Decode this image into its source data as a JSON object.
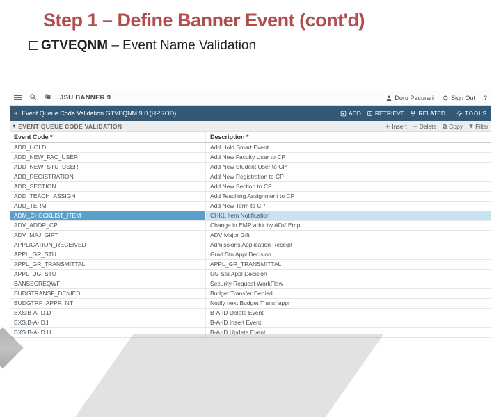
{
  "slide": {
    "title": "Step 1 – Define Banner Event (cont'd)",
    "sub_bold": "GTVEQNM",
    "sub_rest": " – Event Name Validation"
  },
  "topbar": {
    "brand": "JSU BANNER 9",
    "user": "Doru Pacurari",
    "signout": "Sign Out",
    "help": "?"
  },
  "subhead": {
    "caret": "×",
    "title": "Event Queue Code Validation GTVEQNM 9.0 (HPROD)",
    "add": "ADD",
    "retrieve": "RETRIEVE",
    "related": "RELATED",
    "tools": "TOOLS"
  },
  "section": {
    "caret": "▾",
    "title": "EVENT QUEUE CODE VALIDATION",
    "insert": "Insert",
    "delete": "Delete",
    "copy": "Copy",
    "filter": "Filter"
  },
  "headers": {
    "code": "Event Code *",
    "desc": "Description *"
  },
  "rows": [
    {
      "code": "ADD_HOLD",
      "desc": "Add Hold Smart Event"
    },
    {
      "code": "ADD_NEW_FAC_USER",
      "desc": "Add New Faculty User to CP"
    },
    {
      "code": "ADD_NEW_STU_USER",
      "desc": "Add New Student User to CP"
    },
    {
      "code": "ADD_REGISTRATION",
      "desc": "Add New Registration to CP"
    },
    {
      "code": "ADD_SECTION",
      "desc": "Add New Section to CP"
    },
    {
      "code": "ADD_TEACH_ASSIGN",
      "desc": "Add Teaching Assignment to CP"
    },
    {
      "code": "ADD_TERM",
      "desc": "Add New Term to CP"
    },
    {
      "code": "ADM_CHECKLIST_ITEM",
      "desc": "CHKL Item Notification",
      "selected": true
    },
    {
      "code": "ADV_ADDR_CP",
      "desc": "Change in EMP addr by ADV Emp"
    },
    {
      "code": "ADV_MAJ_GIFT",
      "desc": "ADV Major Gift"
    },
    {
      "code": "APPLICATION_RECEIVED",
      "desc": "Admissions Application Receipt"
    },
    {
      "code": "APPL_GR_STU",
      "desc": "Grad Stu Appl Decision"
    },
    {
      "code": "APPL_GR_TRANSMITTAL",
      "desc": "APPL_GR_TRANSMITTAL"
    },
    {
      "code": "APPL_UG_STU",
      "desc": "UG Stu Appl Decision"
    },
    {
      "code": "BANSECREQWF",
      "desc": "Security Request WorkFlow"
    },
    {
      "code": "BUDGTRANSF_DENIED",
      "desc": "Budget Transfer Denied"
    },
    {
      "code": "BUDGTRF_APPR_NT",
      "desc": "Notify next Budget Transf appr"
    },
    {
      "code": "BXS:B-A-ID.D",
      "desc": "B-A-ID Delete Event"
    },
    {
      "code": "BXS:B-A-ID.I",
      "desc": "B-A-ID Insert Event"
    },
    {
      "code": "BXS:B-A-ID.U",
      "desc": "B-A-ID Update Event"
    }
  ]
}
